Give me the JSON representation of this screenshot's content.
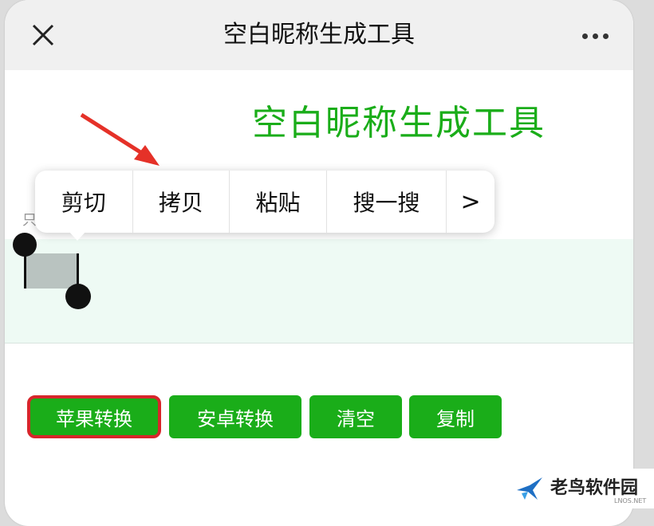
{
  "topbar": {
    "title": "空白昵称生成工具",
    "close_icon": "close-icon",
    "more_icon": "more-icon"
  },
  "main": {
    "heading": "空白昵称生成工具",
    "peek_char": "只"
  },
  "context_menu": {
    "items": [
      {
        "label": "剪切"
      },
      {
        "label": "拷贝"
      },
      {
        "label": "粘贴"
      },
      {
        "label": "搜一搜"
      },
      {
        "label": ">"
      }
    ]
  },
  "buttons": {
    "apple": "苹果转换",
    "android": "安卓转换",
    "clear": "清空",
    "copy": "复制"
  },
  "watermark": {
    "text": "老鸟软件园",
    "sub": "LNOS.NET"
  },
  "colors": {
    "accent_green": "#1aad19",
    "highlight_red": "#d7262b",
    "edit_area_bg": "#eefaf4"
  }
}
